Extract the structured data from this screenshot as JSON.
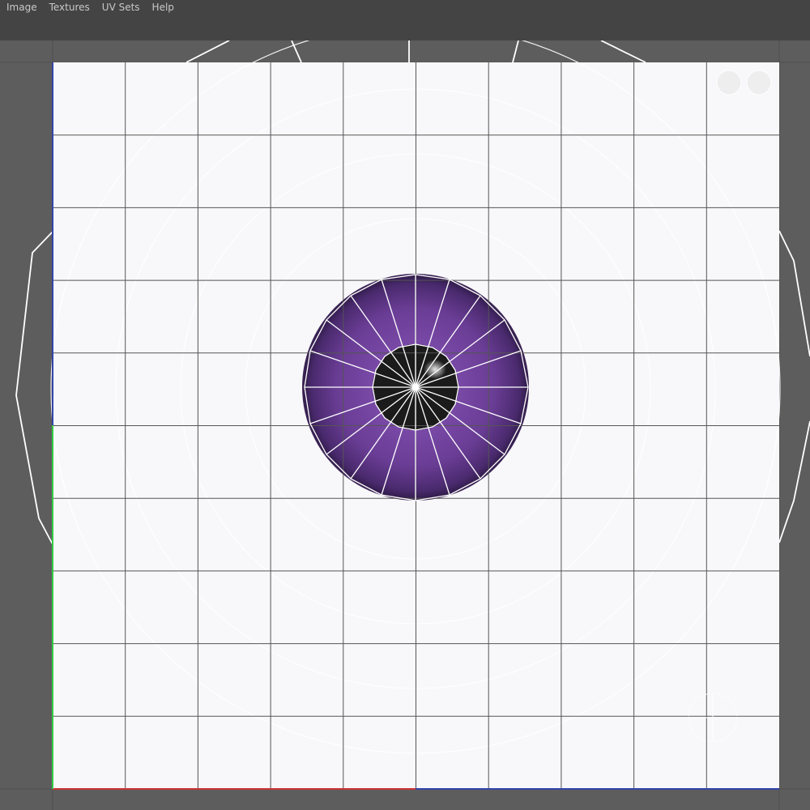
{
  "menubar": {
    "items": [
      {
        "label": "Image",
        "name": "menu-image"
      },
      {
        "label": "Textures",
        "name": "menu-textures"
      },
      {
        "label": "UV Sets",
        "name": "menu-uv-sets"
      },
      {
        "label": "Help",
        "name": "menu-help"
      }
    ]
  },
  "viewport": {
    "texture": "eye-iris-texture",
    "iris_color": "#6a3d95",
    "pupil_color": "#1b1b1b",
    "grid_line_color": "#555555",
    "canvas_color": "#f8f8fb",
    "background_color": "#5d5d5d",
    "uv_axis_u_color": "#cc3333",
    "uv_axis_v_color": "#33cc44",
    "icons": [
      "display-toggle-icon",
      "crosshair-manipulator-icon"
    ]
  }
}
